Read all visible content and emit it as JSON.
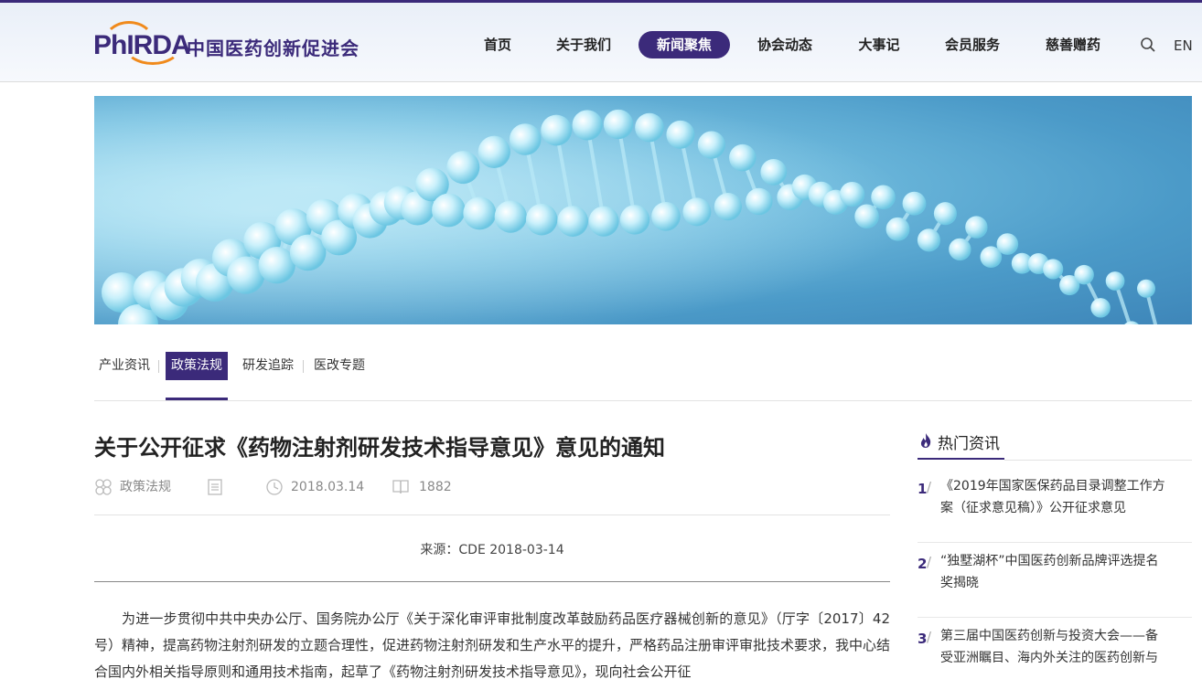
{
  "header": {
    "logo_en": "PhIRDA",
    "logo_cn": "中国医药创新促进会",
    "nav": [
      {
        "label": "首页",
        "active": false
      },
      {
        "label": "关于我们",
        "active": false
      },
      {
        "label": "新闻聚焦",
        "active": true
      },
      {
        "label": "协会动态",
        "active": false
      },
      {
        "label": "大事记",
        "active": false
      },
      {
        "label": "会员服务",
        "active": false
      },
      {
        "label": "慈善赠药",
        "active": false
      }
    ],
    "search_icon": "search-icon",
    "lang": "EN"
  },
  "subnav": {
    "items": [
      {
        "label": "产业资讯",
        "active": false
      },
      {
        "label": "政策法规",
        "active": true
      },
      {
        "label": "研发追踪",
        "active": false
      },
      {
        "label": "医改专题",
        "active": false
      }
    ]
  },
  "article": {
    "title": "关于公开征求《药物注射剂研发技术指导意见》意见的通知",
    "meta": {
      "category": "政策法规",
      "date": "2018.03.14",
      "views": "1882"
    },
    "source": "来源：CDE 2018-03-14",
    "body": "为进一步贯彻中共中央办公厅、国务院办公厅《关于深化审评审批制度改革鼓励药品医疗器械创新的意见》（厅字〔2017〕42号）精神，提高药物注射剂研发的立题合理性，促进药物注射剂研发和生产水平的提升，严格药品注册审评审批技术要求，我中心结合国内外相关指导原则和通用技术指南，起草了《药物注射剂研发技术指导意见》，现向社会公开征"
  },
  "sidebar": {
    "title": "热门资讯",
    "items": [
      {
        "num": "1",
        "text": "《2019年国家医保药品目录调整工作方案（征求意见稿）》公开征求意见"
      },
      {
        "num": "2",
        "text": "“独墅湖杯”中国医药创新品牌评选提名奖揭晓"
      },
      {
        "num": "3",
        "text": "第三届中国医药创新与投资大会——备受亚洲瞩目、海内外关注的医药创新与"
      }
    ]
  },
  "colors": {
    "brand_purple": "#3b2a7a",
    "brand_orange": "#f08a1c",
    "banner_blue": "#74bfe0"
  }
}
